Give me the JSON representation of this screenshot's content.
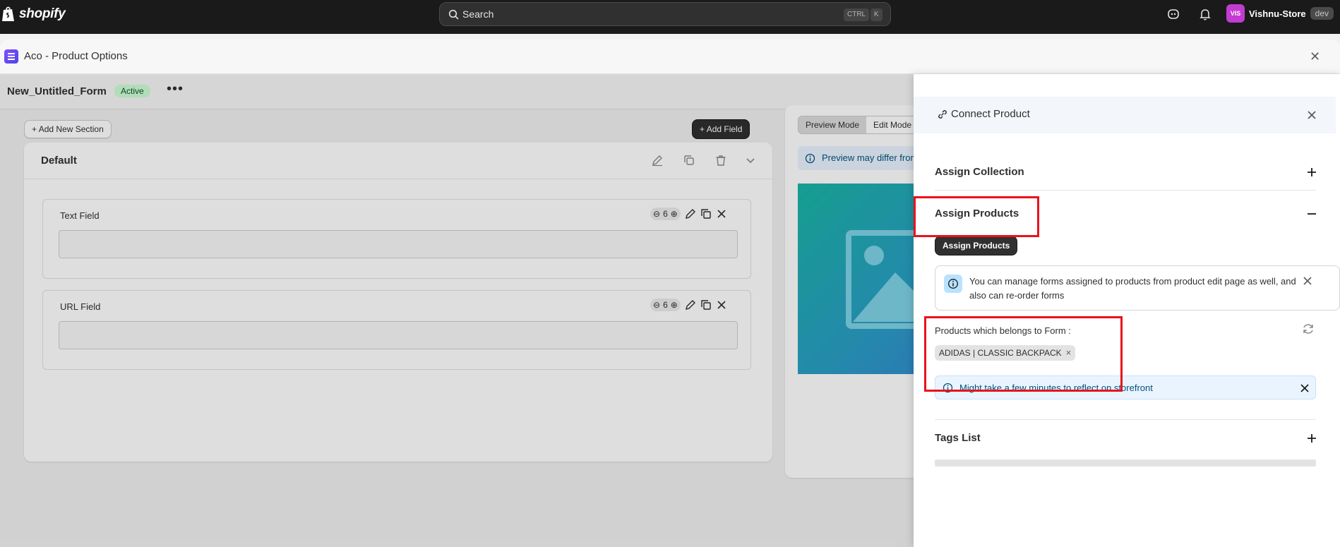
{
  "topbar": {
    "brand": "shopify",
    "search_placeholder": "Search",
    "shortcut_ctrl": "CTRL",
    "shortcut_key": "K",
    "store_initials": "VIS",
    "store_name": "Vishnu-Store",
    "store_badge": "dev"
  },
  "app": {
    "title": "Aco - Product Options"
  },
  "form": {
    "name": "New_Untitled_Form",
    "status": "Active",
    "more": "•••",
    "add_section": "Add New Section",
    "add_field": "Add Field"
  },
  "section": {
    "title": "Default",
    "fields": [
      {
        "label": "Text Field",
        "width": "6"
      },
      {
        "label": "URL Field",
        "width": "6"
      }
    ]
  },
  "preview": {
    "mode_preview": "Preview Mode",
    "mode_edit": "Edit Mode",
    "note": "Preview may differ from storefront"
  },
  "drawer": {
    "title": "Connect Product",
    "assign_collection": "Assign Collection",
    "assign_products": "Assign Products",
    "assign_products_button": "Assign Products",
    "info_text": "You can manage forms assigned to products from product edit page as well, and also can re-order forms",
    "products_label": "Products which belongs to Form :",
    "products": [
      "ADIDAS | CLASSIC BACKPACK"
    ],
    "notice": "Might take a few minutes to reflect on storefront",
    "tags_list": "Tags List"
  },
  "colors": {
    "topbar": "#1a1a1a",
    "accent_dark": "#303030",
    "highlight": "#e8131c",
    "info_bg": "#eaf4ff",
    "active_badge": "#cdfed4"
  }
}
